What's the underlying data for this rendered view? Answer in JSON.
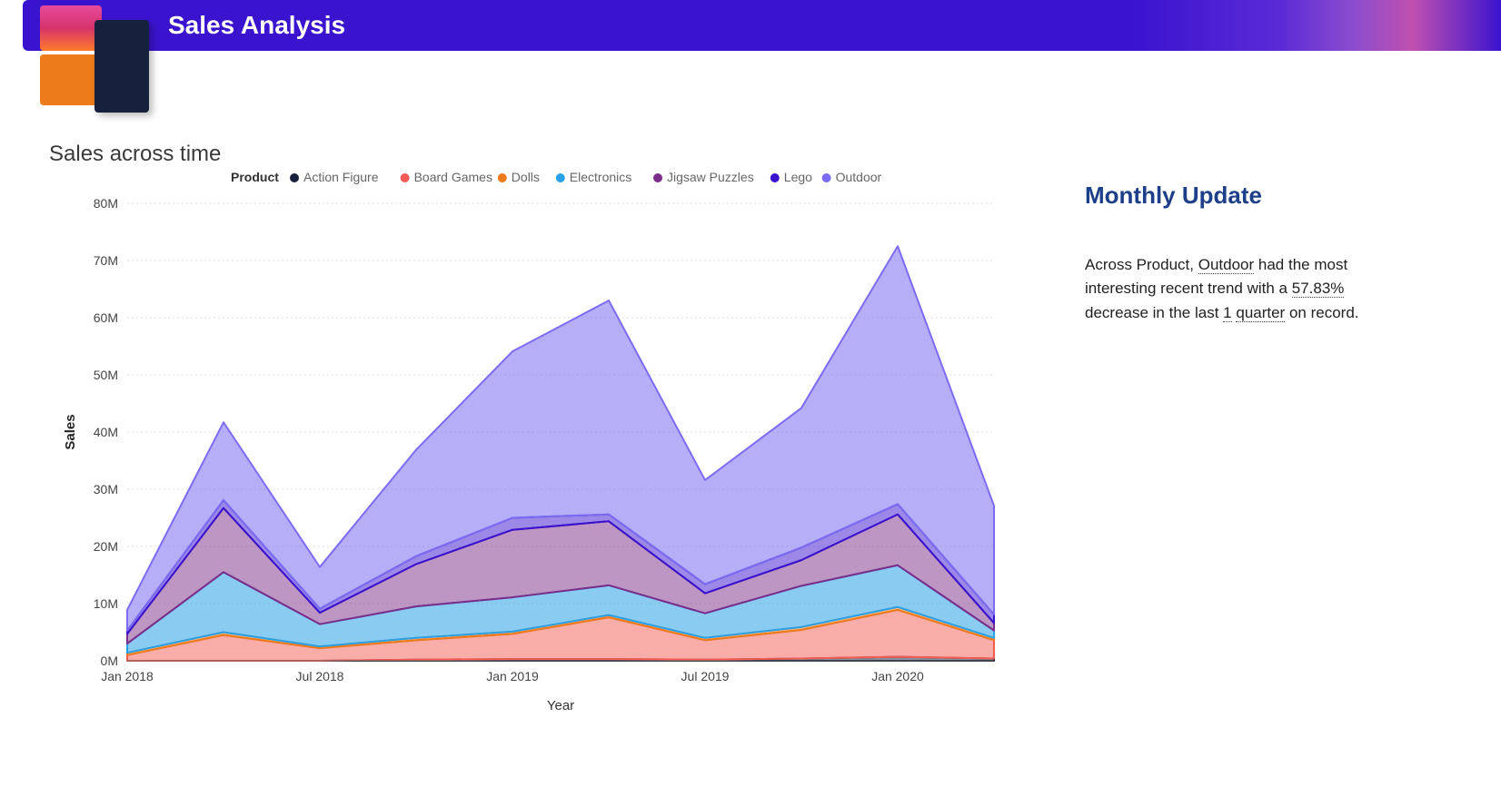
{
  "header": {
    "title": "Sales Analysis"
  },
  "chart_title": "Sales across time",
  "legend_title": "Product",
  "axis": {
    "x": "Year",
    "y": "Sales",
    "y_ticks": [
      "0M",
      "10M",
      "20M",
      "30M",
      "40M",
      "50M",
      "60M",
      "70M",
      "80M"
    ],
    "x_ticks": [
      "Jan 2018",
      "Jul 2018",
      "Jan 2019",
      "Jul 2019",
      "Jan 2020"
    ]
  },
  "side": {
    "title": "Monthly Update",
    "t1": "Across Product, ",
    "link1": "Outdoor",
    "t2": " had the most interesting recent trend with a ",
    "link2": "57.83%",
    "t3": " decrease in the last ",
    "link3": "1",
    "t4": " ",
    "link4": "quarter",
    "t5": " on record."
  },
  "chart_data": {
    "type": "area",
    "stacked": true,
    "title": "Sales across time",
    "xlabel": "Year",
    "ylabel": "Sales",
    "ylim": [
      0,
      80
    ],
    "yunit": "M",
    "x": [
      "Jan 2018",
      "Apr 2018",
      "Jul 2018",
      "Oct 2018",
      "Jan 2019",
      "Apr 2019",
      "Jul 2019",
      "Oct 2019",
      "Jan 2020",
      "Apr 2020"
    ],
    "series": [
      {
        "name": "Action Figure",
        "color": "#16223d",
        "values": [
          0,
          0,
          0,
          0.2,
          0.3,
          0.3,
          0.2,
          0.4,
          0.7,
          0.4
        ]
      },
      {
        "name": "Board Games",
        "color": "#f25c54",
        "values": [
          1.0,
          4.5,
          2.2,
          3.4,
          4.4,
          7.3,
          3.4,
          5.0,
          8.2,
          3.2
        ]
      },
      {
        "name": "Dolls",
        "color": "#ed7b1a",
        "values": [
          0.4,
          0.5,
          0.3,
          0.4,
          0.4,
          0.4,
          0.4,
          0.5,
          0.5,
          0.4
        ]
      },
      {
        "name": "Electronics",
        "color": "#2aa1e6",
        "values": [
          1.6,
          10.5,
          3.9,
          5.5,
          6.0,
          5.2,
          4.3,
          7.2,
          7.3,
          1.3
        ]
      },
      {
        "name": "Jigsaw Puzzles",
        "color": "#7b2e8a",
        "values": [
          1.7,
          11.2,
          2.0,
          7.4,
          11.8,
          11.2,
          3.5,
          4.5,
          8.9,
          1.3
        ]
      },
      {
        "name": "Lego",
        "color": "#3a13cf",
        "values": [
          0.6,
          1.4,
          0.7,
          1.4,
          2.1,
          1.2,
          1.6,
          2.2,
          1.8,
          1.5
        ]
      },
      {
        "name": "Outdoor",
        "color": "#7c6cf2",
        "values": [
          3.6,
          13.6,
          7.3,
          18.6,
          29.1,
          37.4,
          18.2,
          24.4,
          45.1,
          19.0
        ]
      }
    ]
  }
}
